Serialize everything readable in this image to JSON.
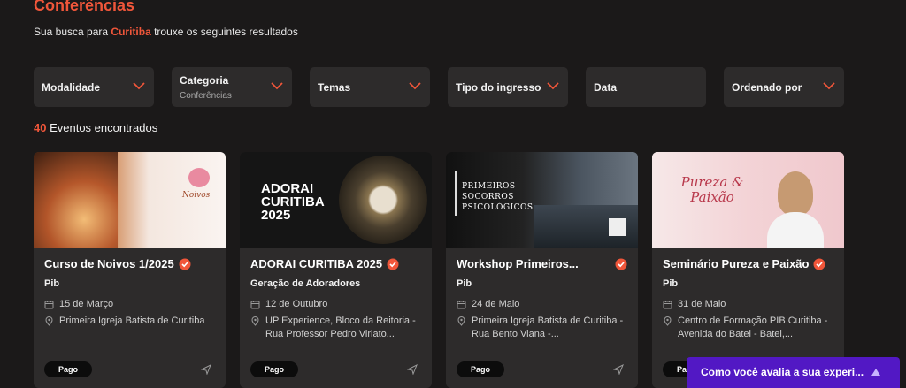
{
  "header": {
    "title": "Conferências",
    "subtitle_prefix": "Sua busca para ",
    "subtitle_city": "Curitiba",
    "subtitle_suffix": " trouxe os seguintes resultados"
  },
  "filters": [
    {
      "label": "Modalidade",
      "value": "",
      "has_chevron": true
    },
    {
      "label": "Categoria",
      "value": "Conferências",
      "has_chevron": true
    },
    {
      "label": "Temas",
      "value": "",
      "has_chevron": true
    },
    {
      "label": "Tipo do ingresso",
      "value": "",
      "has_chevron": true
    },
    {
      "label": "Data",
      "value": "",
      "has_chevron": false
    },
    {
      "label": "Ordenado por",
      "value": "",
      "has_chevron": true
    }
  ],
  "results": {
    "count": "40",
    "label": " Eventos encontrados"
  },
  "events": [
    {
      "title": "Curso de Noivos 1/2025",
      "organizer": "Pib",
      "date": "15 de Março",
      "address": "Primeira Igreja Batista de Curitiba",
      "badge": "Pago",
      "banner_text": "Noivos"
    },
    {
      "title": "ADORAI CURITIBA 2025",
      "organizer": "Geração de Adoradores",
      "date": "12 de Outubro",
      "address": "UP Experience, Bloco da Reitoria - Rua Professor Pedro Viriato...",
      "badge": "Pago",
      "banner_text": "ADORAI CURITIBA 2025"
    },
    {
      "title": "Workshop Primeiros...",
      "organizer": "Pib",
      "date": "24 de Maio",
      "address": "Primeira Igreja Batista de Curitiba - Rua Bento Viana -...",
      "badge": "Pago",
      "banner_text": "PRIMEIROS SOCORROS PSICOLÓGICOS"
    },
    {
      "title": "Seminário Pureza e Paixão",
      "organizer": "Pib",
      "date": "31 de Maio",
      "address": "Centro de Formação PIB Curitiba - Avenida do Batel - Batel,...",
      "badge": "Pago",
      "banner_text": "Pureza & Paixão"
    }
  ],
  "feedback": {
    "label": "Como você avalia a sua experi..."
  },
  "colors": {
    "accent": "#f0563a",
    "background": "#1b1919",
    "card": "#2d2b2b",
    "feedback": "#5218c4"
  }
}
